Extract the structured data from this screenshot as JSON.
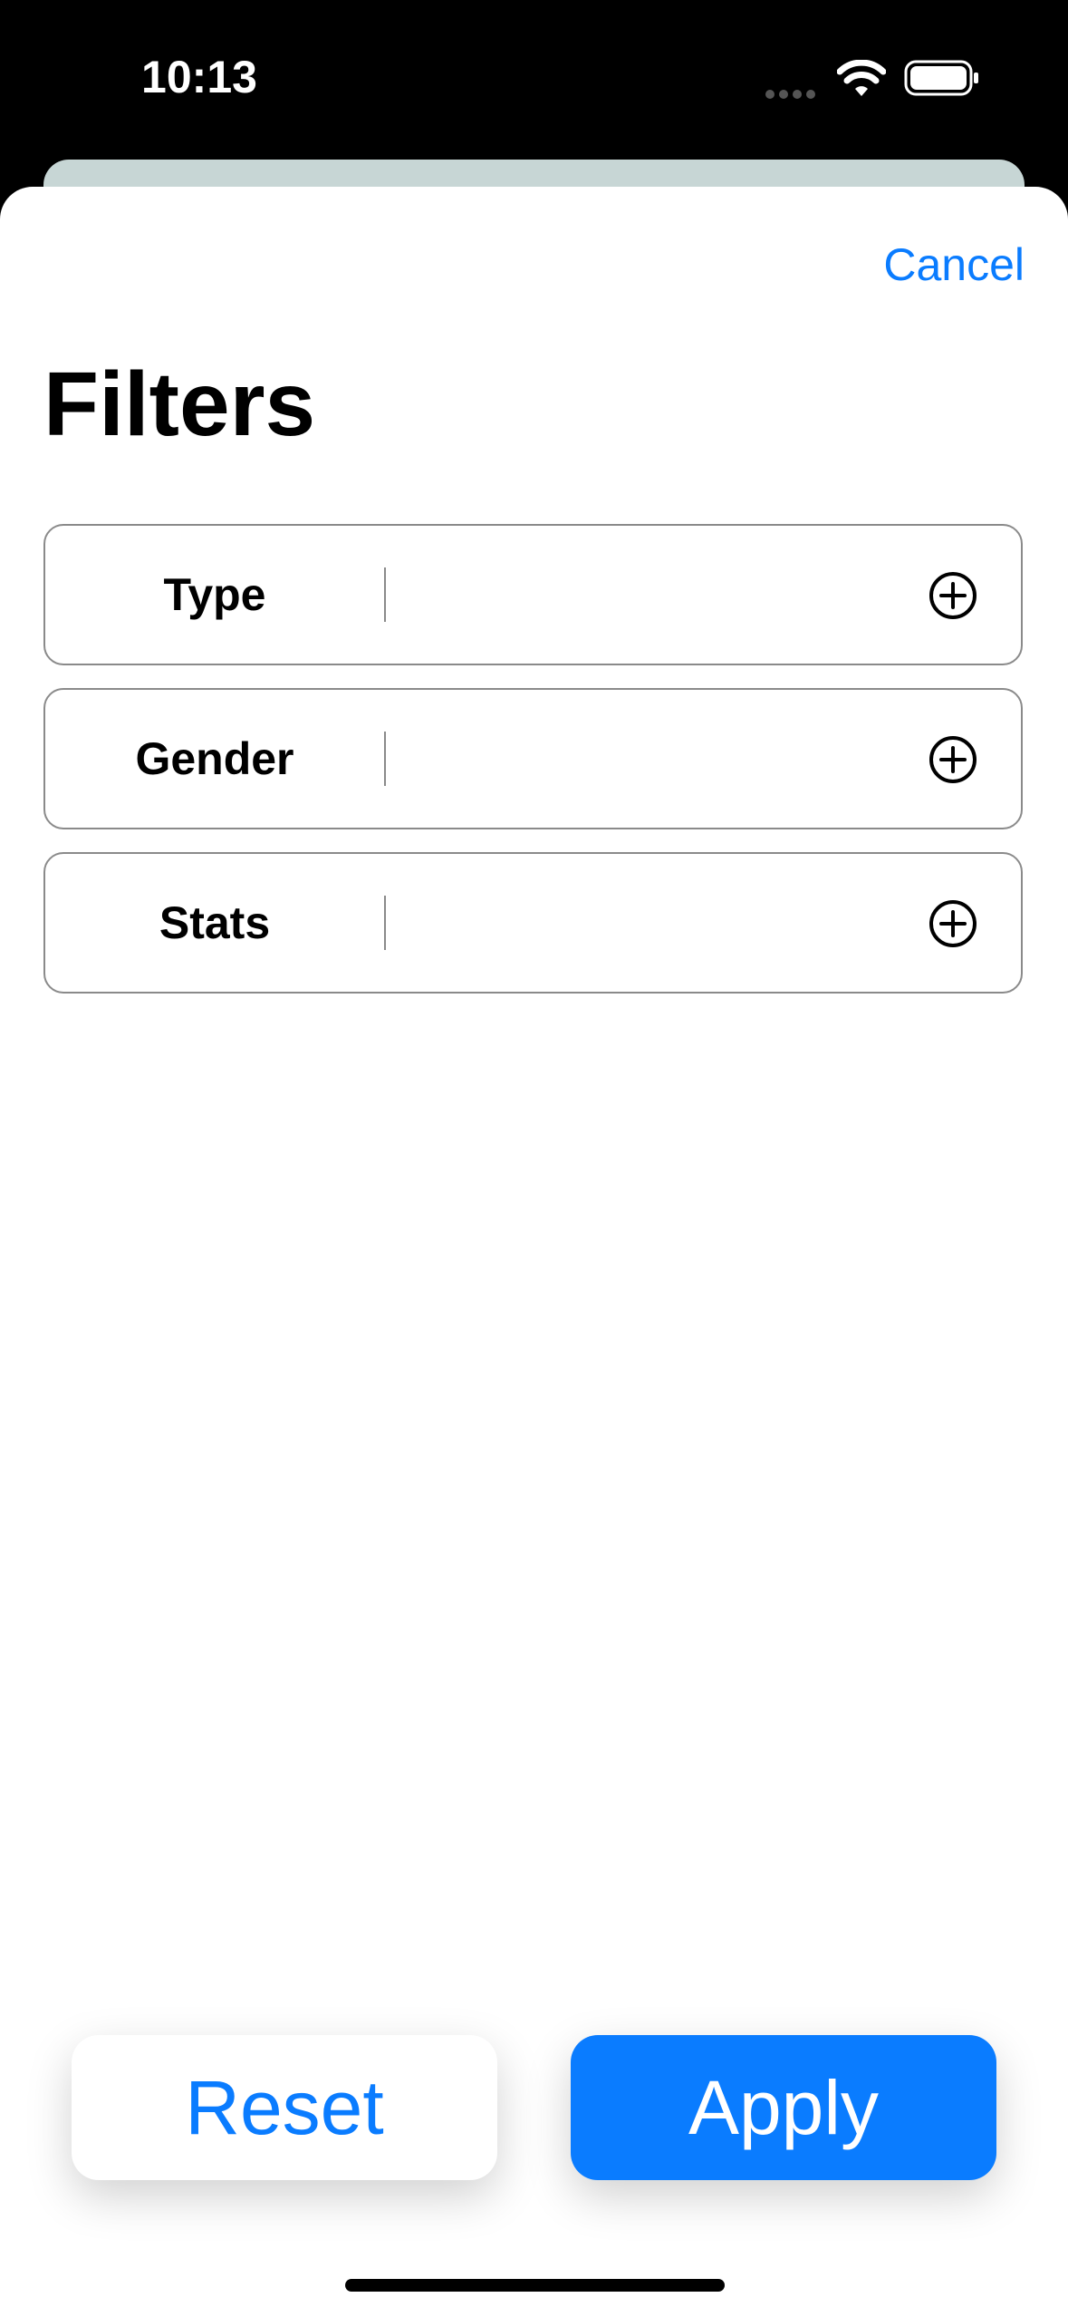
{
  "status_bar": {
    "time": "10:13",
    "icons": [
      "signal-dots-icon",
      "wifi-icon",
      "battery-icon"
    ]
  },
  "sheet": {
    "cancel_label": "Cancel",
    "title": "Filters",
    "filters": [
      {
        "label": "Type",
        "icon": "plus-circle-icon"
      },
      {
        "label": "Gender",
        "icon": "plus-circle-icon"
      },
      {
        "label": "Stats",
        "icon": "plus-circle-icon"
      }
    ],
    "reset_label": "Reset",
    "apply_label": "Apply"
  },
  "colors": {
    "accent": "#0a7cff",
    "border": "#8a8a8a",
    "back_card": "#c7d6d5"
  }
}
